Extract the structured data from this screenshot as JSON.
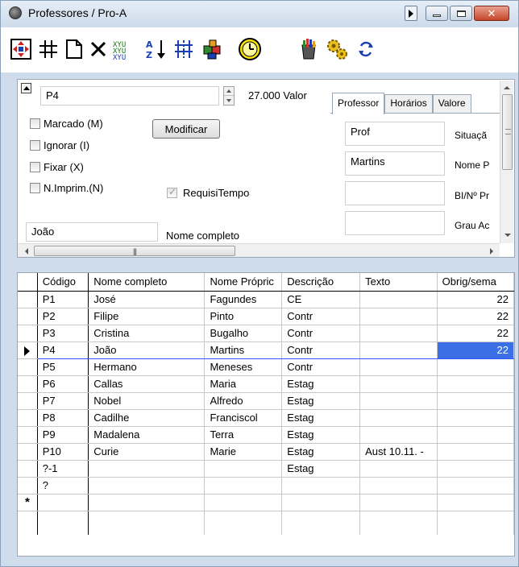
{
  "window": {
    "title": "Professores / Pro-A",
    "icon": "app-gear-icon"
  },
  "toolbar": {
    "tools": [
      {
        "name": "arrows-select-icon"
      },
      {
        "name": "grid-icon"
      },
      {
        "name": "new-document-icon"
      },
      {
        "name": "delete-icon"
      },
      {
        "name": "swap-columns-icon"
      },
      {
        "name": "sort-az-icon"
      },
      {
        "name": "split-icon"
      },
      {
        "name": "puzzle-icon"
      },
      {
        "name": "clock-icon"
      },
      {
        "name": "paint-bucket-icon"
      },
      {
        "name": "gears-icon"
      },
      {
        "name": "refresh-icon"
      }
    ]
  },
  "form": {
    "code_value": "P4",
    "number_value": "27.000",
    "number_label": "Valor",
    "modify_button": "Modificar",
    "checkboxes": [
      {
        "label": "Marcado (M)",
        "checked": false
      },
      {
        "label": "Ignorar (I)",
        "checked": false
      },
      {
        "label": "Fixar (X)",
        "checked": false
      },
      {
        "label": "N.Imprim.(N)",
        "checked": false
      }
    ],
    "requisitempo_label": "RequisiTempo",
    "name_value": "João",
    "name_label": "Nome completo"
  },
  "tabs": {
    "items": [
      "Professor",
      "Horários",
      "Valore"
    ],
    "fields": [
      {
        "value": "Prof",
        "label": "Situaçã"
      },
      {
        "value": "Martins",
        "label": "Nome P"
      },
      {
        "value": "",
        "label": "BI/Nº Pr"
      },
      {
        "value": "",
        "label": "Grau Ac"
      }
    ]
  },
  "grid": {
    "columns": [
      "Código",
      "Nome completo",
      "Nome Própric",
      "Descrição",
      "Texto",
      "Obrig/sema"
    ],
    "rows": [
      {
        "code": "P1",
        "nome": "José",
        "proprio": "Fagundes",
        "desc": "CE",
        "texto": "",
        "obrig": "22"
      },
      {
        "code": "P2",
        "nome": "Filipe",
        "proprio": "Pinto",
        "desc": "Contr",
        "texto": "",
        "obrig": "22"
      },
      {
        "code": "P3",
        "nome": "Cristina",
        "proprio": "Bugalho",
        "desc": "Contr",
        "texto": "",
        "obrig": "22"
      },
      {
        "code": "P4",
        "nome": "João",
        "proprio": "Martins",
        "desc": "Contr",
        "texto": "",
        "obrig": "22",
        "current": true
      },
      {
        "code": "P5",
        "nome": "Hermano",
        "proprio": "Meneses",
        "desc": "Contr",
        "texto": "",
        "obrig": ""
      },
      {
        "code": "P6",
        "nome": "Callas",
        "proprio": "Maria",
        "desc": "Estag",
        "texto": "",
        "obrig": ""
      },
      {
        "code": "P7",
        "nome": "Nobel",
        "proprio": "Alfredo",
        "desc": "Estag",
        "texto": "",
        "obrig": ""
      },
      {
        "code": "P8",
        "nome": "Cadilhe",
        "proprio": "Franciscol",
        "desc": "Estag",
        "texto": "",
        "obrig": ""
      },
      {
        "code": "P9",
        "nome": "Madalena",
        "proprio": "Terra",
        "desc": "Estag",
        "texto": "",
        "obrig": ""
      },
      {
        "code": "P10",
        "nome": "Curie",
        "proprio": "Marie",
        "desc": "Estag",
        "texto": "Aust 10.11. -",
        "obrig": ""
      },
      {
        "code": "?-1",
        "nome": "",
        "proprio": "",
        "desc": "Estag",
        "texto": "",
        "obrig": ""
      },
      {
        "code": "?",
        "nome": "",
        "proprio": "",
        "desc": "",
        "texto": "",
        "obrig": ""
      }
    ],
    "new_row_marker": "*",
    "selection_color": "#3a6fe6"
  }
}
